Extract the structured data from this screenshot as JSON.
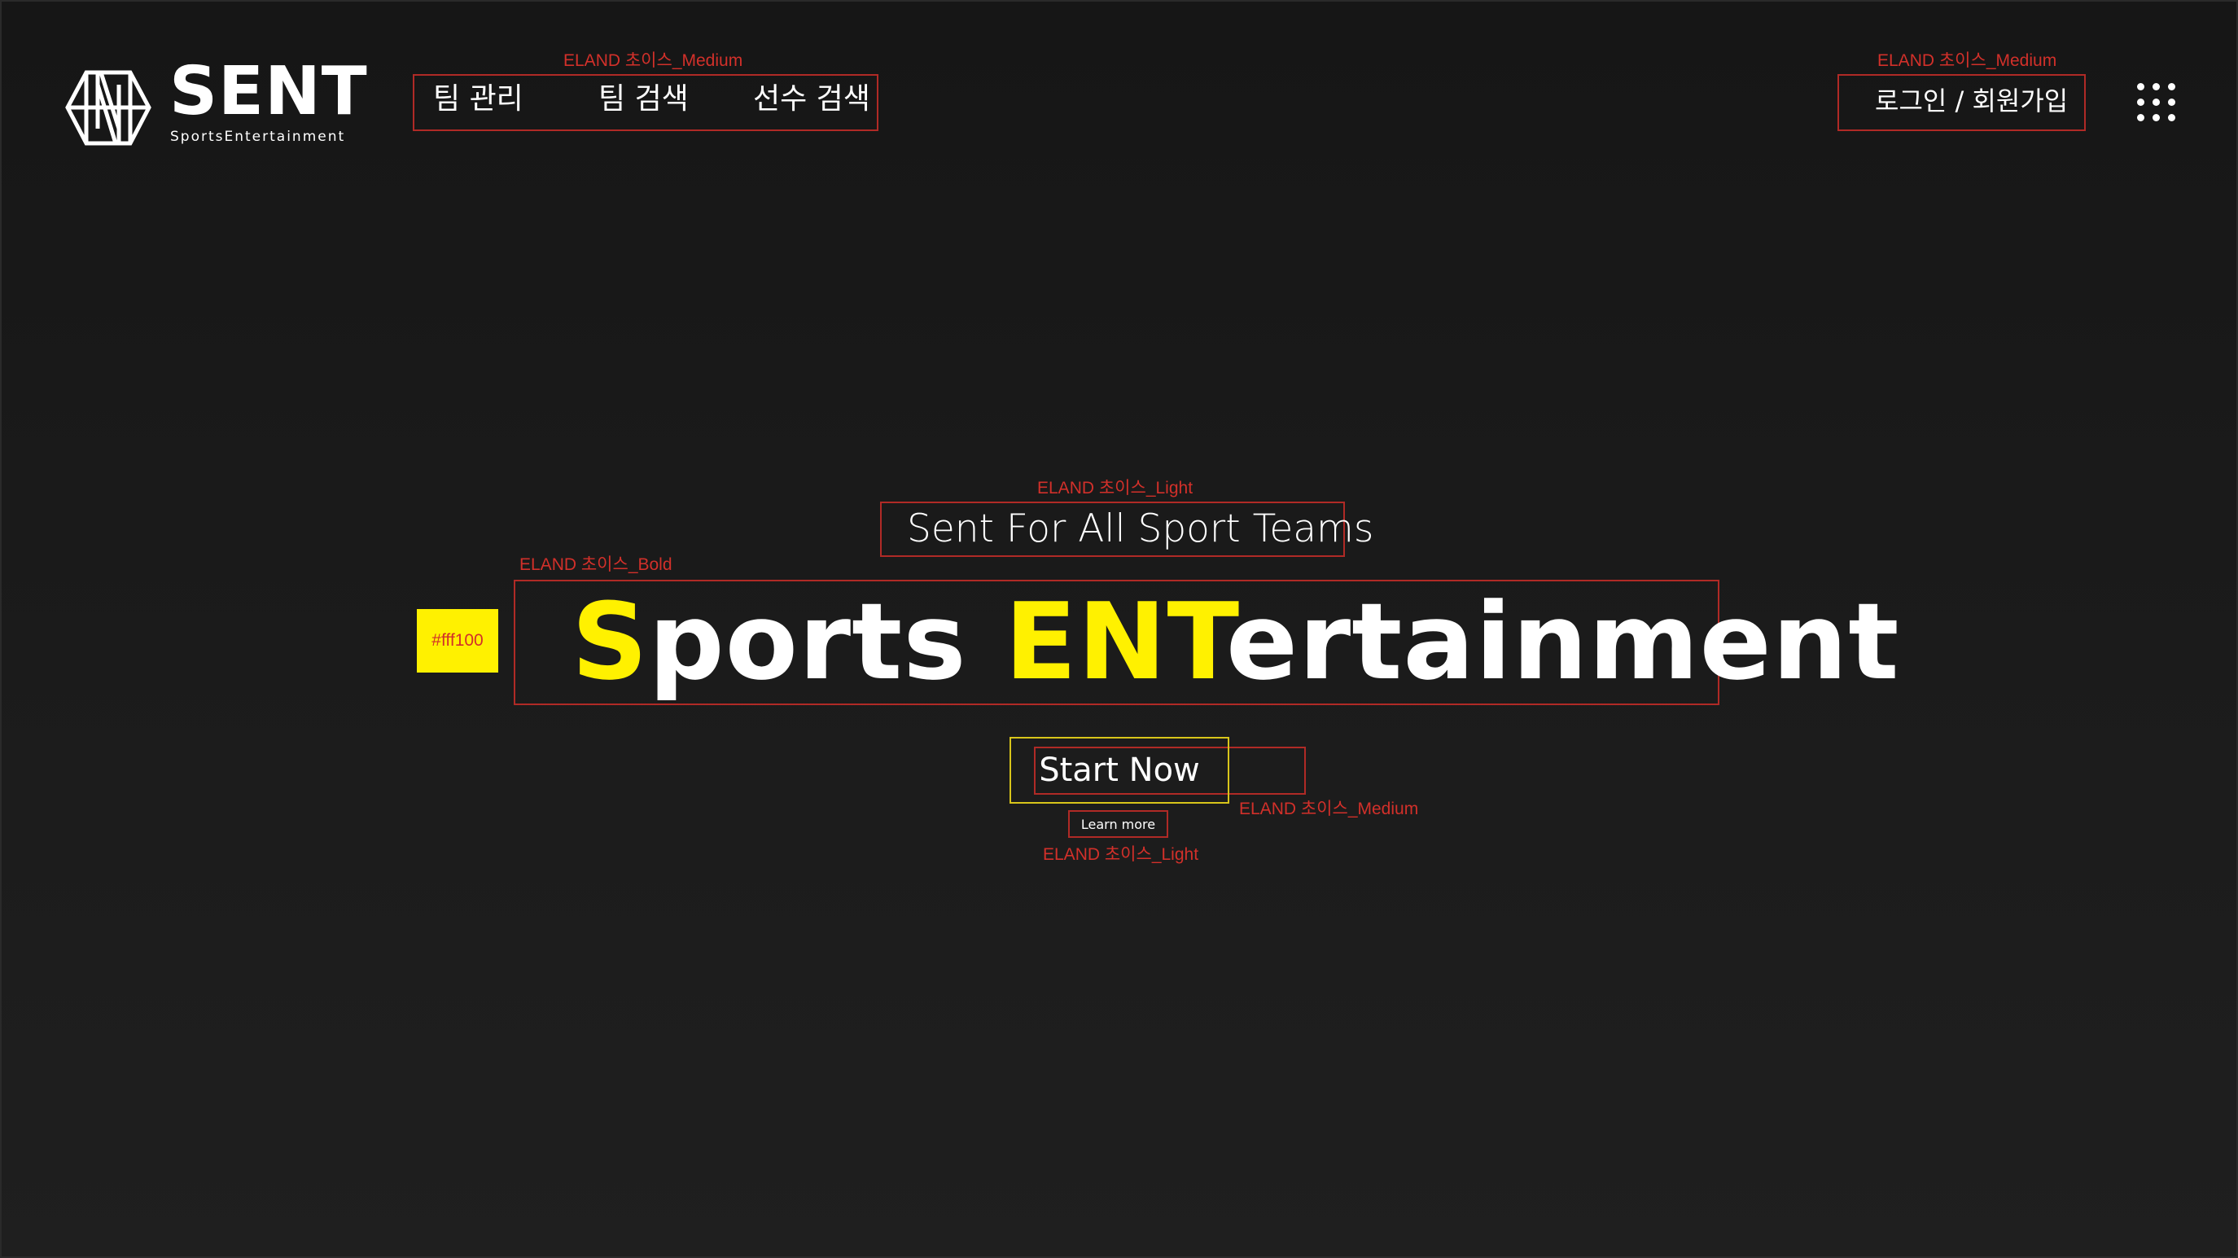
{
  "brand": {
    "name": "SENT",
    "tagline": "SportsEntertainment"
  },
  "nav": {
    "items": [
      "팀 관리",
      "팀 검색",
      "선수 검색"
    ],
    "login": "로그인 / 회원가입"
  },
  "hero": {
    "subtitle": "Sent For All Sport Teams",
    "title_parts": [
      "S",
      "ports ",
      "ENT",
      "ertainment"
    ],
    "primary_button": "Start Now",
    "secondary_button": "Learn more"
  },
  "annotations": {
    "nav_font": "ELAND 초이스_Medium",
    "login_font": "ELAND 초이스_Medium",
    "subtitle_font": "ELAND 초이스_Light",
    "title_font": "ELAND 초이스_Bold",
    "button_font": "ELAND 초이스_Medium",
    "learn_font": "ELAND 초이스_Light",
    "swatch_label": "#fff100"
  },
  "colors": {
    "accent": "#fff100",
    "background": "#1a1a1a",
    "annotation": "#d2302a"
  }
}
